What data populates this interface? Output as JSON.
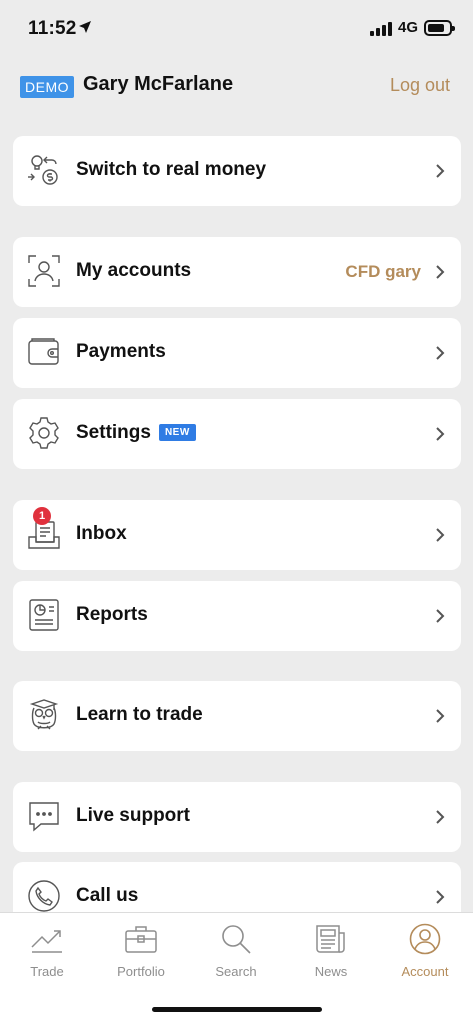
{
  "status_bar": {
    "time": "11:52",
    "network": "4G"
  },
  "profile": {
    "badge": "DEMO",
    "name": "Gary McFarlane",
    "logout_label": "Log out"
  },
  "menu": {
    "switch_real": {
      "label": "Switch to real money"
    },
    "my_accounts": {
      "label": "My accounts",
      "value": "CFD gary"
    },
    "payments": {
      "label": "Payments"
    },
    "settings": {
      "label": "Settings",
      "badge": "NEW"
    },
    "inbox": {
      "label": "Inbox",
      "notification_count": "1"
    },
    "reports": {
      "label": "Reports"
    },
    "learn": {
      "label": "Learn to trade"
    },
    "live_support": {
      "label": "Live support"
    },
    "call_us": {
      "label": "Call us"
    }
  },
  "tabs": [
    {
      "label": "Trade",
      "icon": "trend-icon"
    },
    {
      "label": "Portfolio",
      "icon": "briefcase-icon"
    },
    {
      "label": "Search",
      "icon": "search-icon"
    },
    {
      "label": "News",
      "icon": "newspaper-icon"
    },
    {
      "label": "Account",
      "icon": "account-icon",
      "active": true
    }
  ],
  "colors": {
    "accent": "#b48c5b",
    "demo": "#3f93e8",
    "new_badge": "#2f7ce4",
    "notification": "#e0313d",
    "background": "#ececec"
  }
}
